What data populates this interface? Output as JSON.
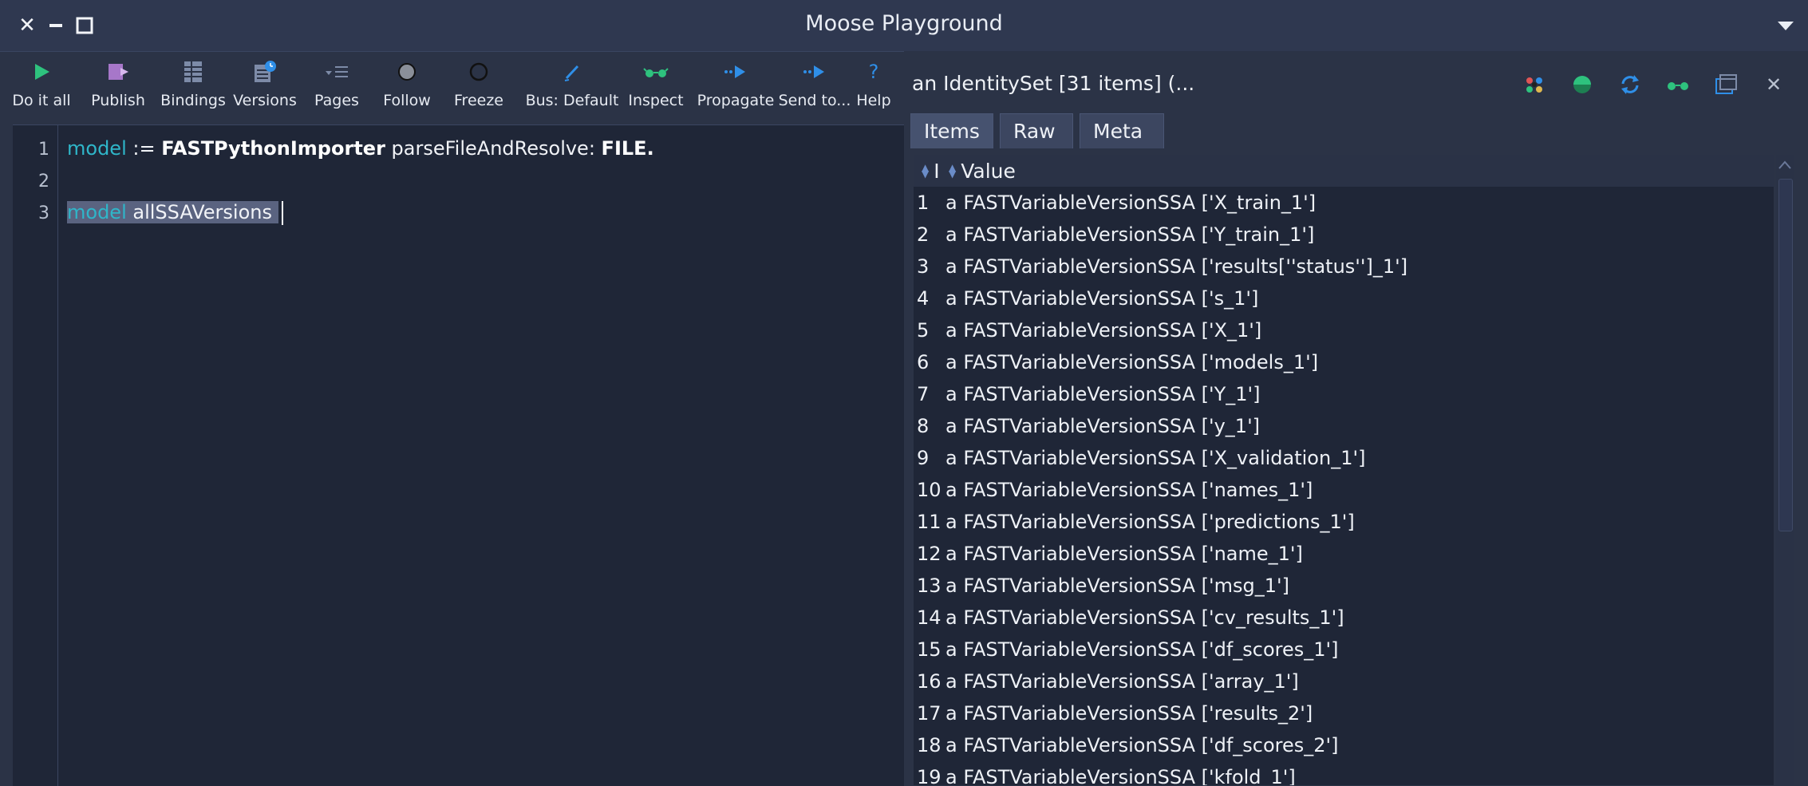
{
  "window": {
    "title": "Moose Playground"
  },
  "toolbar": {
    "do_it_all": "Do it all",
    "publish": "Publish",
    "bindings": "Bindings",
    "versions": "Versions",
    "pages": "Pages",
    "follow": "Follow",
    "freeze": "Freeze",
    "bus": "Bus: Default",
    "inspect": "Inspect",
    "propagate": "Propagate",
    "send_to": "Send to...",
    "help": "Help"
  },
  "editor": {
    "lines": [
      {
        "num": "1",
        "var": "model",
        "op": " := ",
        "cls": "FASTPythonImporter",
        "msg": " parseFileAndResolve: ",
        "arg": "FILE",
        "end": "."
      },
      {
        "num": "2"
      },
      {
        "num": "3",
        "var": "model",
        "rest": " allSSAVersions"
      }
    ]
  },
  "inspector": {
    "title": "an IdentitySet [31 items] (...",
    "tabs": [
      "Items",
      "Raw",
      "Meta"
    ],
    "active_tab": "Items",
    "columns": [
      "I",
      "Value"
    ],
    "rows": [
      {
        "i": "1",
        "v": "a FASTVariableVersionSSA ['X_train_1']"
      },
      {
        "i": "2",
        "v": "a FASTVariableVersionSSA ['Y_train_1']"
      },
      {
        "i": "3",
        "v": "a FASTVariableVersionSSA ['results[''status'']_1']"
      },
      {
        "i": "4",
        "v": "a FASTVariableVersionSSA ['s_1']"
      },
      {
        "i": "5",
        "v": "a FASTVariableVersionSSA ['X_1']"
      },
      {
        "i": "6",
        "v": "a FASTVariableVersionSSA ['models_1']"
      },
      {
        "i": "7",
        "v": "a FASTVariableVersionSSA ['Y_1']"
      },
      {
        "i": "8",
        "v": "a FASTVariableVersionSSA ['y_1']"
      },
      {
        "i": "9",
        "v": "a FASTVariableVersionSSA ['X_validation_1']"
      },
      {
        "i": "10",
        "v": "a FASTVariableVersionSSA ['names_1']"
      },
      {
        "i": "11",
        "v": "a FASTVariableVersionSSA ['predictions_1']"
      },
      {
        "i": "12",
        "v": "a FASTVariableVersionSSA ['name_1']"
      },
      {
        "i": "13",
        "v": "a FASTVariableVersionSSA ['msg_1']"
      },
      {
        "i": "14",
        "v": "a FASTVariableVersionSSA ['cv_results_1']"
      },
      {
        "i": "15",
        "v": "a FASTVariableVersionSSA ['df_scores_1']"
      },
      {
        "i": "16",
        "v": "a FASTVariableVersionSSA ['array_1']"
      },
      {
        "i": "17",
        "v": "a FASTVariableVersionSSA ['results_2']"
      },
      {
        "i": "18",
        "v": "a FASTVariableVersionSSA ['df_scores_2']"
      },
      {
        "i": "19",
        "v": "a FASTVariableVersionSSA ['kfold_1']"
      }
    ]
  },
  "colors": {
    "background": "#2b3346",
    "editor_bg": "#1f2637",
    "keyword_cyan": "#2fb6c9",
    "accent_blue": "#2f8fe8",
    "green": "#2ec27e",
    "selection": "#5a6380"
  }
}
